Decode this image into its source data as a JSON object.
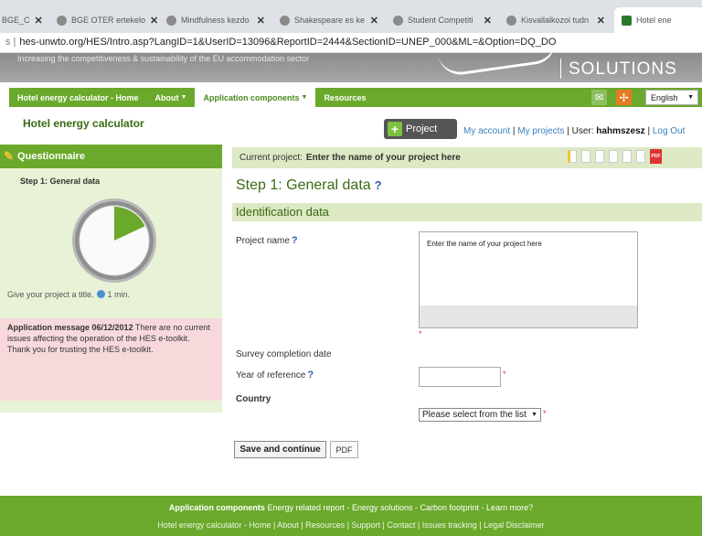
{
  "browser": {
    "tabs": [
      {
        "label": "BGE_C"
      },
      {
        "label": "BGE OTER ertekelo"
      },
      {
        "label": "Mindfulness kezdo"
      },
      {
        "label": "Shakespeare es ke"
      },
      {
        "label": "Student Competiti"
      },
      {
        "label": "Kisvallalkozoi tudn"
      },
      {
        "label": "Hotel ene"
      }
    ],
    "url_prefix": "s |",
    "url": "hes-unwto.org/HES/Intro.asp?LangID=1&UserID=13096&ReportID=2444&SectionID=UNEP_000&ML=&Option=DQ_DO"
  },
  "banner": {
    "tagline": "Increasing the competitiveness & sustainability of the EU accommodation sector",
    "solutions": "SOLUTIONS"
  },
  "nav": {
    "items": [
      {
        "label": "Hotel energy calculator - Home"
      },
      {
        "label": "About"
      },
      {
        "label": "Application components"
      },
      {
        "label": "Resources"
      }
    ],
    "language": "English"
  },
  "header": {
    "app_title": "Hotel energy calculator",
    "project_button": "Project",
    "my_account": "My account",
    "my_projects": "My projects",
    "user_label": "User:",
    "username": "hahmszesz",
    "logout": "Log Out",
    "sep": "|"
  },
  "sidebar": {
    "title": "Questionnaire",
    "step": "Step 1: General data",
    "progress_fraction": 0.18,
    "hint": "Give your project a title.",
    "hint_time": "1 min.",
    "message_title": "Application message 06/12/2012",
    "message_body": "There are no current issues affecting the operation of the HES e-toolkit.",
    "message_thanks": "Thank you for trusting the HES e-toolkit."
  },
  "main": {
    "current_project_label": "Current project:",
    "current_project_name": "Enter the name of your project here",
    "step_title": "Step 1: General data",
    "help_mark": "?",
    "section_title": "Identification data",
    "project_name_label": "Project name",
    "project_name_value": "Enter the name of your project here",
    "survey_date_label": "Survey completion date",
    "year_label": "Year of reference",
    "country_label": "Country",
    "country_select": "Please select from the list",
    "required_mark": "*",
    "save_button": "Save and continue",
    "pdf_button": "PDF"
  },
  "footer": {
    "components_label": "Application components",
    "components_links": "Energy related report -  Energy solutions -  Carbon footprint -  Learn more?",
    "links": "Hotel energy calculator - Home  |  About  |  Resources  |  Support  |  Contact  |  Issues tracking  |  Legal Disclaimer"
  },
  "colors": {
    "brand_green": "#6aa92b",
    "light_green": "#dce9c4",
    "message_pink": "#f7d9dc"
  }
}
